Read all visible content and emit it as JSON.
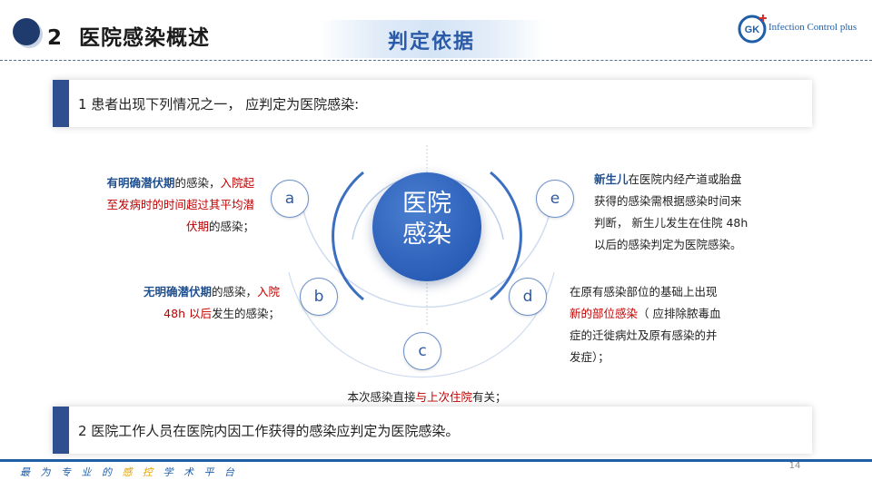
{
  "header": {
    "section_number": "2",
    "section_title": "医院感染概述",
    "badge": "判定依据",
    "logo_initials": "GK",
    "logo_text": "Infection Control plus"
  },
  "bar1": {
    "text": "1 患者出现下列情况之一， 应判定为医院感染:"
  },
  "bar2": {
    "text": "2 医院工作人员在医院内因工作获得的感染应判定为医院感染。"
  },
  "diagram": {
    "center": {
      "line1": "医院",
      "line2": "感染"
    },
    "nodes": {
      "a": "a",
      "b": "b",
      "c": "c",
      "d": "d",
      "e": "e"
    },
    "a": {
      "line1_bold": "有明确潜伏期",
      "line1_plain": "的感染，",
      "line1_red": "入院起",
      "line2_red": "至发病时的时间超过其平均潜",
      "line3_red": "伏期",
      "line3_plain": "的感染；"
    },
    "b": {
      "line1_bold": "无明确潜伏期",
      "line1_plain": "的感染，",
      "line1_red": "入院",
      "line2_red": "48h 以后",
      "line2_plain": "发生的感染；"
    },
    "c": {
      "plain1": "本次感染直接",
      "red": "与上次住院",
      "plain2": "有关；"
    },
    "d": {
      "line1": "在原有感染部位的基础上出现",
      "line2_red": "新的部位感染",
      "line2_plain": "（ 应排除脓毒血",
      "line3": "症的迁徙病灶及原有感染的并",
      "line4": "发症）；"
    },
    "e": {
      "line1_bold": "新生儿",
      "line1_plain": "在医院内经产道或胎盘",
      "line2": "获得的感染需根据感染时间来",
      "line3": "判断， 新生儿发生在住院 48h",
      "line4": "以后的感染判定为医院感染。"
    }
  },
  "footer": {
    "slogan_pre": "最 为 专 业 的 ",
    "slogan_hl": "感 控",
    "slogan_post": " 学 术 平 台",
    "page_number": "14"
  },
  "colors": {
    "accent": "#2f4f8f",
    "highlight": "#c00000",
    "title_blue": "#1f4f8f",
    "node_border": "#6a8fcb"
  }
}
